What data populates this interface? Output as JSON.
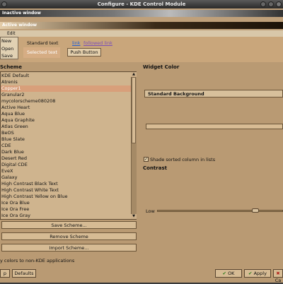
{
  "window": {
    "title": "Configure - KDE Control Module"
  },
  "preview": {
    "inactive_window_label": "Inactive window",
    "active_window_label": "Active window",
    "menu_item": "Edit",
    "menu_items": [
      "New",
      "Open",
      "Save"
    ],
    "standard_text": "Standard text",
    "link_text": "link",
    "followed_link_text": "followed link",
    "selected_text": "Selected text",
    "push_button": "Push Button"
  },
  "scheme": {
    "header": "Scheme",
    "items": [
      "KDE Default",
      "Atrenis",
      "Copper1",
      "Granular2",
      "mycolorscheme080208",
      "Active Heart",
      "Aqua Blue",
      "Aqua Graphite",
      "Atlas Green",
      "BeOS",
      "Blue Slate",
      "CDE",
      "Dark Blue",
      "Desert Red",
      "Digital CDE",
      "EveX",
      "Galaxy",
      "High Contrast Black Text",
      "High Contrast White Text",
      "High Contrast Yellow on Blue",
      "Ice Ora Blue",
      "Ice Ora Free",
      "Ice Ora Gray"
    ],
    "selected_index": 2,
    "save_button": "Save Scheme...",
    "remove_button": "Remove Scheme",
    "import_button": "Import Scheme..."
  },
  "widget_color": {
    "label": "Widget Color",
    "combo_value": "Standard Background",
    "swatch_color": "#d8bc94",
    "shade_sorted_label": "Shade sorted column in lists",
    "shade_sorted_checked": true
  },
  "contrast": {
    "label": "Contrast",
    "low_label": "Low",
    "slider_fraction": 0.8
  },
  "apply_colors_text": "y colors to non-KDE applications",
  "footer": {
    "help": "p",
    "defaults": "Defaults",
    "ok": "OK",
    "apply": "Apply",
    "cancel": "Ca"
  },
  "colors": {
    "accent": "#d89f7a",
    "background": "#b99a73",
    "list_background": "#cfb48e"
  }
}
